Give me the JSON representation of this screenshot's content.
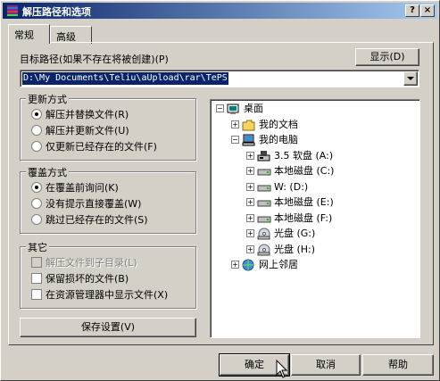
{
  "window": {
    "title": "解压路径和选项",
    "help_btn": "?",
    "close_btn": "×"
  },
  "tabs": [
    {
      "label": "常规",
      "active": true
    },
    {
      "label": "高级",
      "active": false
    }
  ],
  "target": {
    "label": "目标路径(如果不存在将被创建)(P)",
    "value": "D:\\My Documents\\Teliu\\aUpload\\rar\\TePS",
    "show_button": "显示(D)"
  },
  "update_mode": {
    "title": "更新方式",
    "options": [
      {
        "label": "解压并替换文件(R)",
        "selected": true
      },
      {
        "label": "解压并更新文件(U)",
        "selected": false
      },
      {
        "label": "仅更新已经存在的文件(F)",
        "selected": false
      }
    ]
  },
  "overwrite_mode": {
    "title": "覆盖方式",
    "options": [
      {
        "label": "在覆盖前询问(K)",
        "selected": true
      },
      {
        "label": "没有提示直接覆盖(W)",
        "selected": false
      },
      {
        "label": "跳过已经存在的文件(S)",
        "selected": false
      }
    ]
  },
  "misc": {
    "title": "其它",
    "options": [
      {
        "label": "解压文件到子目录(L)",
        "checked": false,
        "disabled": true
      },
      {
        "label": "保留损坏的文件(B)",
        "checked": false,
        "disabled": false
      },
      {
        "label": "在资源管理器中显示文件(X)",
        "checked": false,
        "disabled": false
      }
    ]
  },
  "save_button": "保存设置(V)",
  "tree": {
    "nodes": [
      {
        "label": "桌面",
        "icon": "desktop-icon",
        "level": 0,
        "expander": "-"
      },
      {
        "label": "我的文档",
        "icon": "folder-icon",
        "level": 1,
        "expander": "+"
      },
      {
        "label": "我的电脑",
        "icon": "computer-icon",
        "level": 1,
        "expander": "-"
      },
      {
        "label": "3.5 软盘 (A:)",
        "icon": "floppy-icon",
        "level": 2,
        "expander": "+"
      },
      {
        "label": "本地磁盘 (C:)",
        "icon": "drive-icon",
        "level": 2,
        "expander": "+"
      },
      {
        "label": "W: (D:)",
        "icon": "drive-icon",
        "level": 2,
        "expander": "+"
      },
      {
        "label": "本地磁盘 (E:)",
        "icon": "drive-icon",
        "level": 2,
        "expander": "+"
      },
      {
        "label": "本地磁盘 (F:)",
        "icon": "drive-icon",
        "level": 2,
        "expander": "+"
      },
      {
        "label": "光盘 (G:)",
        "icon": "cdrom-icon",
        "level": 2,
        "expander": "+"
      },
      {
        "label": "光盘 (H:)",
        "icon": "cdrom-icon",
        "level": 2,
        "expander": "+"
      },
      {
        "label": "网上邻居",
        "icon": "network-icon",
        "level": 1,
        "expander": "+"
      }
    ]
  },
  "footer": {
    "ok": "确定",
    "cancel": "取消",
    "help": "帮助"
  },
  "colors": {
    "titlebar_start": "#0a246a",
    "titlebar_end": "#a6caf0",
    "face": "#d4d0c8",
    "selection": "#0a246a"
  }
}
